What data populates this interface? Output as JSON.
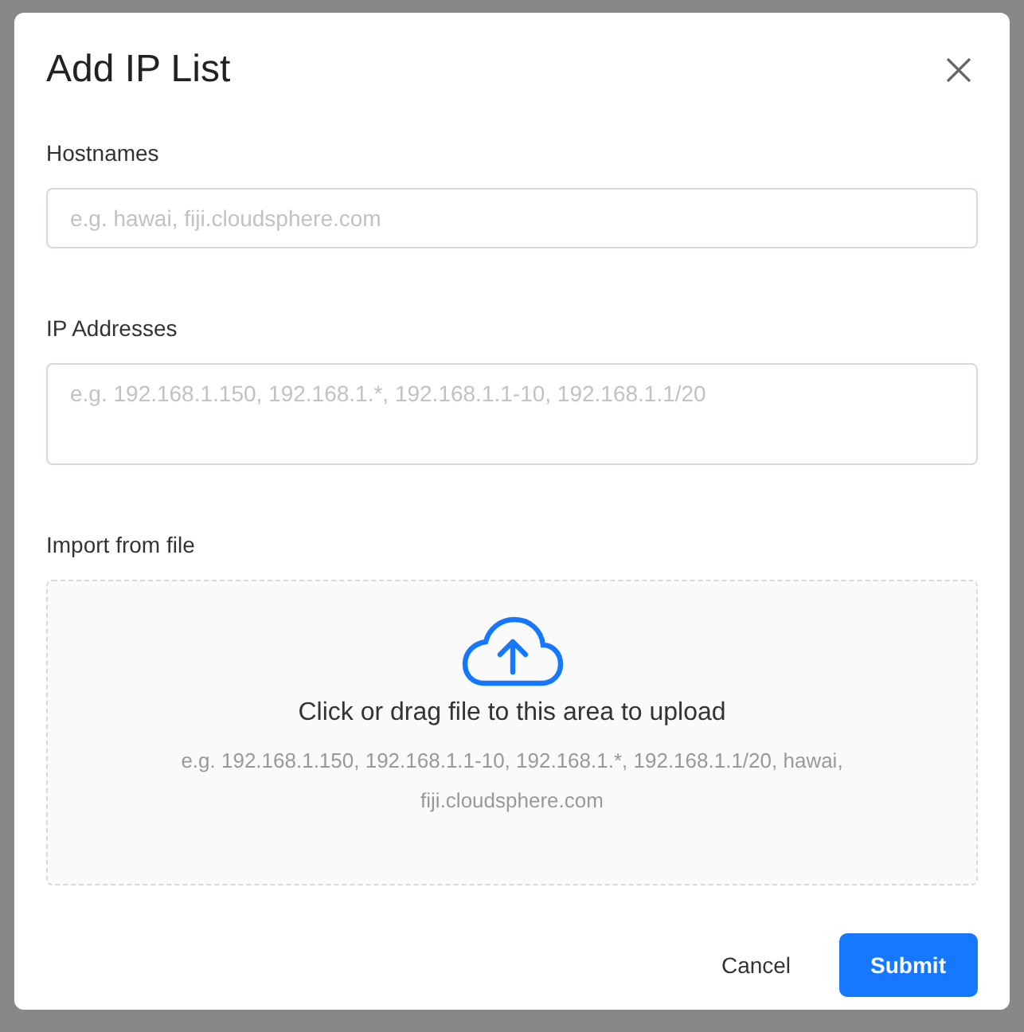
{
  "dialog": {
    "title": "Add IP List"
  },
  "fields": [
    {
      "kind": "input",
      "label": "Hostnames",
      "placeholder": "e.g. hawai, fiji.cloudsphere.com"
    },
    {
      "kind": "textarea",
      "label": "IP Addresses",
      "placeholder": "e.g. 192.168.1.150, 192.168.1.*, 192.168.1.1-10, 192.168.1.1/20"
    }
  ],
  "import": {
    "label": "Import from file",
    "title": "Click or drag file to this area to upload",
    "hint": "e.g. 192.168.1.150, 192.168.1.1-10, 192.168.1.*, 192.168.1.1/20, hawai, fiji.cloudsphere.com"
  },
  "buttons": [
    {
      "kind": "text",
      "label": "Cancel"
    },
    {
      "kind": "primary",
      "label": "Submit"
    }
  ]
}
